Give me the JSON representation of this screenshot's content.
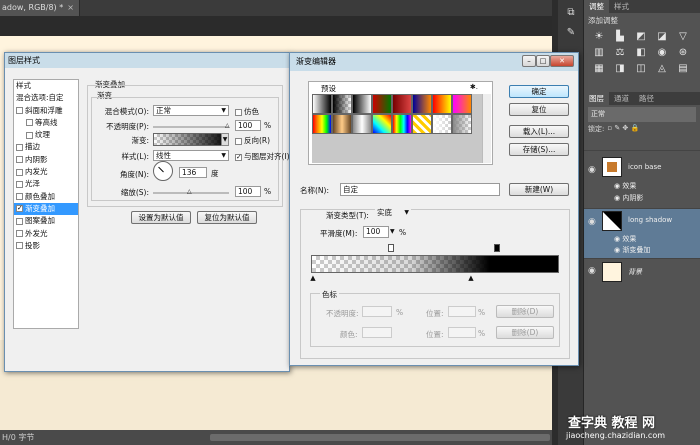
{
  "document": {
    "tab": "adow, RGB/8) *",
    "close": "×"
  },
  "status_bar": {
    "text": "H/0 字节"
  },
  "dock_icons": [
    "history-icon",
    "brush-icon",
    "type-icon",
    "paragraph-icon",
    "character-icon",
    "info-icon"
  ],
  "adjustments_panel": {
    "tabs": [
      "调整",
      "样式"
    ],
    "title": "添加调整",
    "icons": [
      "brightness-icon",
      "levels-icon",
      "curves-icon",
      "exposure-icon",
      "vibrance-icon",
      "hue-icon",
      "color-balance-icon",
      "bw-icon",
      "photo-filter-icon",
      "channel-mixer-icon",
      "lookup-icon",
      "invert-icon",
      "posterize-icon",
      "threshold-icon",
      "gradient-map-icon",
      "selective-color-icon"
    ]
  },
  "layers_panel": {
    "tabs": [
      "图层",
      "通道",
      "路径"
    ],
    "kind_filter": "类型",
    "blend_mode": "正常",
    "lock_label": "锁定:",
    "layers": [
      {
        "name": "icon base",
        "effects_label": "效果",
        "effects": [
          "内阴影"
        ]
      },
      {
        "name": "long shadow",
        "effects_label": "效果",
        "effects": [
          "渐变叠加"
        ]
      },
      {
        "name": "背景",
        "effects_label": "",
        "effects": []
      }
    ]
  },
  "layer_style": {
    "title": "图层样式",
    "sidebar": [
      {
        "label": "样式",
        "checkbox": false,
        "checked": false,
        "selected": false,
        "indent": 0
      },
      {
        "label": "混合选项:自定",
        "checkbox": false,
        "checked": false,
        "selected": false,
        "indent": 0
      },
      {
        "label": "斜面和浮雕",
        "checkbox": true,
        "checked": false,
        "selected": false,
        "indent": 0
      },
      {
        "label": "等高线",
        "checkbox": true,
        "checked": false,
        "selected": false,
        "indent": 1
      },
      {
        "label": "纹理",
        "checkbox": true,
        "checked": false,
        "selected": false,
        "indent": 1
      },
      {
        "label": "描边",
        "checkbox": true,
        "checked": false,
        "selected": false,
        "indent": 0
      },
      {
        "label": "内阴影",
        "checkbox": true,
        "checked": false,
        "selected": false,
        "indent": 0
      },
      {
        "label": "内发光",
        "checkbox": true,
        "checked": false,
        "selected": false,
        "indent": 0
      },
      {
        "label": "光泽",
        "checkbox": true,
        "checked": false,
        "selected": false,
        "indent": 0
      },
      {
        "label": "颜色叠加",
        "checkbox": true,
        "checked": false,
        "selected": false,
        "indent": 0
      },
      {
        "label": "渐变叠加",
        "checkbox": true,
        "checked": true,
        "selected": true,
        "indent": 0
      },
      {
        "label": "图案叠加",
        "checkbox": true,
        "checked": false,
        "selected": false,
        "indent": 0
      },
      {
        "label": "外发光",
        "checkbox": true,
        "checked": false,
        "selected": false,
        "indent": 0
      },
      {
        "label": "投影",
        "checkbox": true,
        "checked": false,
        "selected": false,
        "indent": 0
      }
    ],
    "section_title": "渐变叠加",
    "group_title": "渐变",
    "blend_mode_label": "混合模式(O):",
    "blend_mode_value": "正常",
    "dither_label": "仿色",
    "opacity_label": "不透明度(P):",
    "opacity_value": "100",
    "opacity_unit": "%",
    "gradient_label": "渐变:",
    "reverse_label": "反向(R)",
    "style_label": "样式(L):",
    "style_value": "线性",
    "align_label": "与图层对齐(I)",
    "angle_label": "角度(N):",
    "angle_value": "136",
    "angle_unit": "度",
    "scale_label": "缩放(S):",
    "scale_value": "100",
    "scale_unit": "%",
    "make_default": "设置为默认值",
    "reset_default": "复位为默认值"
  },
  "gradient_editor": {
    "title": "渐变编辑器",
    "presets_label": "预设",
    "gear": "✱.",
    "ok": "确定",
    "reset": "复位",
    "load": "载入(L)...",
    "save": "存储(S)...",
    "name_label": "名称(N):",
    "name_value": "自定",
    "new_button": "新建(W)",
    "type_label": "渐变类型(T):",
    "type_value": "实底",
    "smooth_label": "平滑度(M):",
    "smooth_value": "100",
    "smooth_unit": "%",
    "stops_group": "色标",
    "opacity_label": "不透明度:",
    "location_label": "位置:",
    "color_label": "颜色:",
    "delete_label": "删除(D)",
    "pct": "%"
  },
  "watermark": {
    "line1": "查字典 教程 网",
    "line2": "jiaocheng.chazidian.com"
  }
}
